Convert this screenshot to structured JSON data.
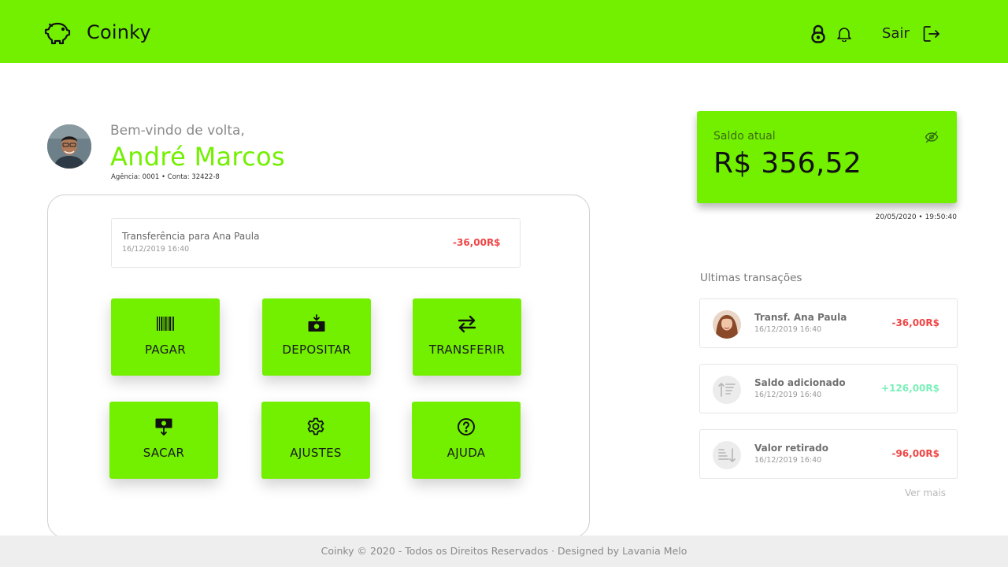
{
  "header": {
    "brand": "Coinky",
    "logout_label": "Sair",
    "accent_color": "#72f000",
    "icons": [
      "piggy-bank-icon",
      "lock-icon",
      "bell-icon",
      "logout-icon"
    ]
  },
  "welcome": {
    "greeting": "Bem-vindo de volta,",
    "name": "André Marcos",
    "account": "Agência: 0001 • Conta: 32422-8"
  },
  "last_transaction": {
    "title": "Transferência para Ana Paula",
    "date": "16/12/2019 16:40",
    "amount": "-36,00R$"
  },
  "actions": [
    {
      "label": "PAGAR",
      "icon": "barcode-icon"
    },
    {
      "label": "DEPOSITAR",
      "icon": "deposit-money-icon"
    },
    {
      "label": "TRANSFERIR",
      "icon": "transfer-arrows-icon"
    },
    {
      "label": "SACAR",
      "icon": "withdraw-money-icon"
    },
    {
      "label": "AJUSTES",
      "icon": "gear-icon"
    },
    {
      "label": "AJUDA",
      "icon": "help-icon"
    }
  ],
  "balance": {
    "label": "Saldo atual",
    "value": "R$ 356,52",
    "timestamp": "20/05/2020 • 19:50:40",
    "icon": "eye-off-icon"
  },
  "recent": {
    "title": "Ultimas transações",
    "items": [
      {
        "title": "Transf. Ana Paula",
        "date": "16/12/2019 16:40",
        "amount": "-36,00R$",
        "type": "negative",
        "icon": "contact-avatar"
      },
      {
        "title": "Saldo adicionado",
        "date": "16/12/2019 16:40",
        "amount": "+126,00R$",
        "type": "positive",
        "icon": "sort-up-icon"
      },
      {
        "title": "Valor retirado",
        "date": "16/12/2019 16:40",
        "amount": "-96,00R$",
        "type": "negative",
        "icon": "sort-down-icon"
      }
    ],
    "see_more": "Ver mais"
  },
  "footer": {
    "text": "Coinky © 2020  - Todos os Direitos Reservados · Designed by Lavania Melo"
  },
  "colors": {
    "accent": "#72f000",
    "negative": "#f04545",
    "positive": "#7af0b8"
  }
}
